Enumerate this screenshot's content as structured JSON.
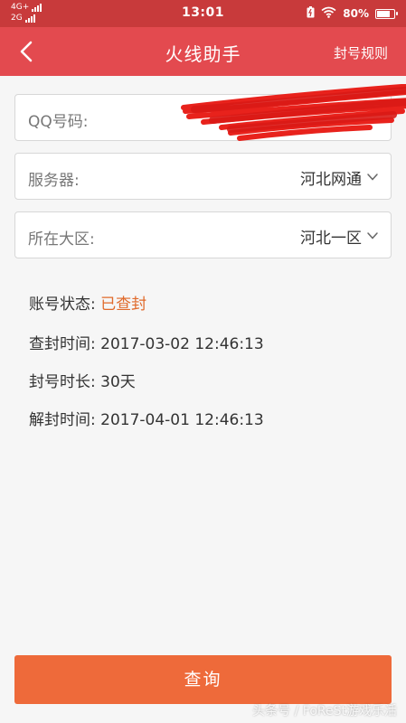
{
  "status_bar": {
    "network_top": "4G+",
    "network_bottom": "2G",
    "time": "13:01",
    "battery": "80%",
    "battery_level": 0.8
  },
  "header": {
    "back_icon": "chevron-left-icon",
    "title": "火线助手",
    "rules_link": "封号规则"
  },
  "form": {
    "qq_label": "QQ号码:",
    "server_label": "服务器:",
    "server_value": "河北网通",
    "region_label": "所在大区:",
    "region_value": "河北一区"
  },
  "info": {
    "status_key": "账号状态: ",
    "status_value": "已查封",
    "ban_time_key": "查封时间: ",
    "ban_time_value": "2017-03-02 12:46:13",
    "duration_key": "封号时长: ",
    "duration_value": "30天",
    "unban_time_key": "解封时间: ",
    "unban_time_value": "2017-04-01 12:46:13"
  },
  "actions": {
    "query_label": "查询"
  },
  "watermark": "头条号 / FoReSt游戏乐活",
  "colors": {
    "status_bar": "#c83a3b",
    "header": "#e34a4f",
    "status_highlight": "#e06a2b",
    "button": "#ee6a3a"
  }
}
